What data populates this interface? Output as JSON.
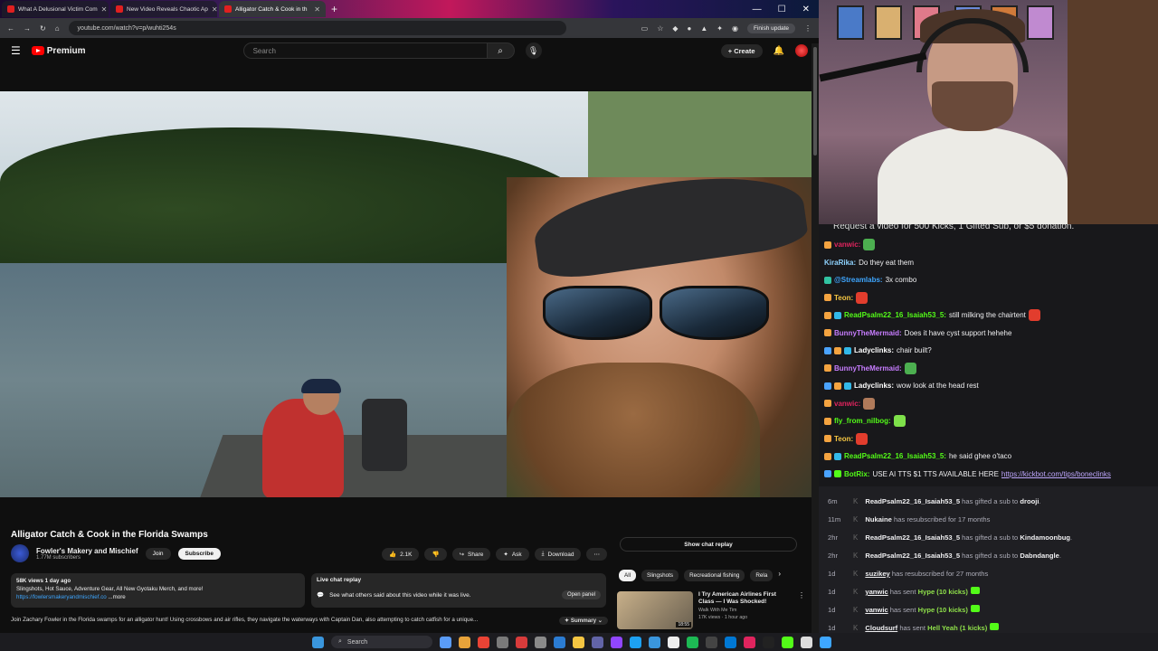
{
  "browser": {
    "tabs": [
      {
        "title": "What A Delusional Victim Com",
        "active": false
      },
      {
        "title": "New Video Reveals Chaotic Ap",
        "active": false
      },
      {
        "title": "Alligator Catch & Cook in th",
        "active": true
      }
    ],
    "url": "youtube.com/watch?v=p/wuhti254s",
    "finish_update": "Finish update"
  },
  "youtube": {
    "logo": "Premium",
    "search_placeholder": "Search",
    "create": "Create",
    "video_title": "Alligator Catch & Cook in the Florida Swamps",
    "channel_name": "Fowler's Makery and Mischief",
    "channel_subs": "1.77M subscribers",
    "join": "Join",
    "subscribe": "Subscribe",
    "likes": "2.1K",
    "share": "Share",
    "ask": "Ask",
    "download": "Download",
    "desc_meta": "58K views  1 day ago",
    "desc_line": "Slingshots, Hot Sauce, Adventure Gear,  All New Gyotaku Merch, and more!",
    "desc_link": "https://fowlersmakeryandmischief.co",
    "desc_more": "...more",
    "live_chat_title": "Live chat replay",
    "live_chat_text": "See what others said about this video while it was live.",
    "open_panel": "Open panel",
    "desc_bottom": "Join Zachary Fowler in the Florida swamps for an alligator hunt! Using crossbows and air rifles, they navigate the waterways with Captain Dan, also attempting to catch catfish for a unique...",
    "summary": "Summary",
    "show_chat_replay": "Show chat replay",
    "chips": [
      "All",
      "Slingshots",
      "Recreational fishing",
      "Rela"
    ],
    "rec": {
      "title": "I Try American Airlines First Class — I Was Shocked!",
      "channel": "Walk With Me Tim",
      "meta": "17K views · 1 hour ago",
      "duration": "18:55"
    }
  },
  "chat": {
    "top_text": "Request a video for 500 Kicks, 1 Gifted Sub, or $5 donation.",
    "messages": [
      {
        "user": "vanwic",
        "color": "#e0245e",
        "text": "",
        "badges": [
          "#f4a340"
        ],
        "emote": "#4caf50"
      },
      {
        "user": "KiraRika",
        "color": "#8fd3ff",
        "text": "Do they eat them",
        "badges": [],
        "emote": ""
      },
      {
        "user": "@Streamlabs",
        "color": "#3ea6ff",
        "text": "3x  combo",
        "badges": [
          "#31c3a2"
        ],
        "emote": ""
      },
      {
        "user": "Teon",
        "color": "#f4c542",
        "text": "",
        "badges": [
          "#f4a340"
        ],
        "emote": "#e23d2d"
      },
      {
        "user": "ReadPsalm22_16_Isaiah53_5",
        "color": "#53fc18",
        "text": "still milking the chairtent",
        "badges": [
          "#f4a340",
          "#32b8e8"
        ],
        "emote": "#e23d2d"
      },
      {
        "user": "BunnyTheMermaid",
        "color": "#c77dff",
        "text": "Does it have cyst support hehehe",
        "badges": [
          "#f4a340"
        ],
        "emote": ""
      },
      {
        "user": "Ladyclinks",
        "color": "#ffffff",
        "text": "chair built?",
        "badges": [
          "#4aa3ff",
          "#f4a340",
          "#32b8e8"
        ],
        "emote": ""
      },
      {
        "user": "BunnyTheMermaid",
        "color": "#c77dff",
        "text": "",
        "badges": [
          "#f4a340"
        ],
        "emote": "#4caf50"
      },
      {
        "user": "Ladyclinks",
        "color": "#ffffff",
        "text": "wow look at the head rest",
        "badges": [
          "#4aa3ff",
          "#f4a340",
          "#32b8e8"
        ],
        "emote": ""
      },
      {
        "user": "vanwic",
        "color": "#e0245e",
        "text": "",
        "badges": [
          "#f4a340"
        ],
        "emote": "#b07a5a"
      },
      {
        "user": "fly_from_nilbog",
        "color": "#53fc18",
        "text": "",
        "badges": [
          "#f4a340"
        ],
        "emote": "#7ee04a"
      },
      {
        "user": "Teon",
        "color": "#f4c542",
        "text": "",
        "badges": [
          "#f4a340"
        ],
        "emote": "#e23d2d"
      },
      {
        "user": "ReadPsalm22_16_Isaiah53_5",
        "color": "#53fc18",
        "text": "he said ghee o'taco",
        "badges": [
          "#f4a340",
          "#32b8e8"
        ],
        "emote": ""
      },
      {
        "user": "BotRix",
        "color": "#53fc18",
        "text": "USE AI TTS $1 TTS AVAILABLE HERE ",
        "link": "https://kickbot.com/tips/boneclinks",
        "badges": [
          "#4aa3ff",
          "#53fc18"
        ],
        "emote": ""
      }
    ]
  },
  "events": [
    {
      "time": "6m",
      "user": "ReadPsalm22_16_Isaiah53_5",
      "pre": "has gifted a sub to",
      "target": "drooji",
      "after": "."
    },
    {
      "time": "11m",
      "user": "Nukaine",
      "pre": "has resubscribed for 17 months",
      "target": "",
      "after": ""
    },
    {
      "time": "2hr",
      "user": "ReadPsalm22_16_Isaiah53_5",
      "pre": "has gifted a sub to",
      "target": "Kindamoonbug",
      "after": "."
    },
    {
      "time": "2hr",
      "user": "ReadPsalm22_16_Isaiah53_5",
      "pre": "has gifted a sub to",
      "target": "Dabndangle",
      "after": "."
    },
    {
      "time": "1d",
      "user": "suzikey",
      "pre": "has resubscribed for 27 months",
      "target": "",
      "after": ""
    },
    {
      "time": "1d",
      "user": "yanwic",
      "pre": "has sent",
      "highlight": "Hype (10 kicks)",
      "target": "",
      "after": ""
    },
    {
      "time": "1d",
      "user": "vanwic",
      "pre": "has sent",
      "highlight": "Hype (10 kicks)",
      "target": "",
      "after": ""
    },
    {
      "time": "1d",
      "user": "Cloudsurf",
      "pre": "has sent",
      "highlight": "Hell Yeah (1 kicks)",
      "target": "",
      "after": ""
    }
  ],
  "taskbar": {
    "search": "Search",
    "icons": [
      "#5a9cf8",
      "#e8a33a",
      "#ea4335",
      "#7a7a7a",
      "#d83b3b",
      "#8a8a8a",
      "#2b7cd3",
      "#f4c542",
      "#6264a7",
      "#9146ff",
      "#1da1f2",
      "#3a96dd",
      "#eeeeee",
      "#1db954",
      "#444444",
      "#0078d4",
      "#e0245e",
      "#222222",
      "#53fc18",
      "#dddddd",
      "#3ea6ff"
    ]
  }
}
